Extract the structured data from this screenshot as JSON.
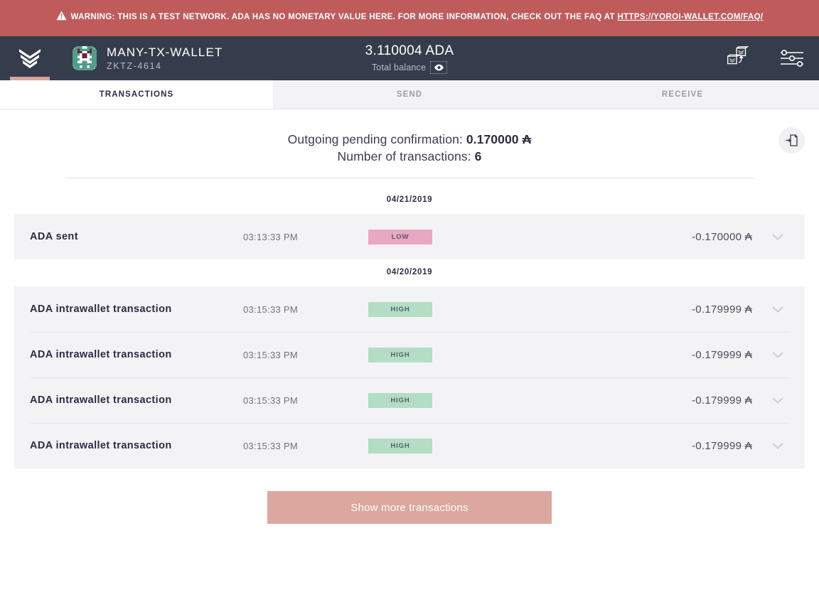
{
  "warning": {
    "icon": "warning-triangle-icon",
    "text": "WARNING: THIS IS A TEST NETWORK. ADA HAS NO MONETARY VALUE HERE. FOR MORE INFORMATION, CHECK OUT THE FAQ AT ",
    "link_text": "HTTPS://YOROI-WALLET.COM/FAQ/",
    "bg_color": "#bf5b5b"
  },
  "navbar": {
    "logo_name": "yoroi-logo",
    "wallet_name": "MANY-TX-WALLET",
    "wallet_plate": "ZKTZ-4614",
    "balance_amount": "3.110004 ADA",
    "balance_label": "Total balance",
    "eye_icon": "eye-icon",
    "wallet_switch_icon": "wallet-switch-icon",
    "settings_icon": "settings-sliders-icon",
    "bg_color": "#353d4c",
    "indicator_color": "#d9a59d"
  },
  "tabs": [
    {
      "label": "TRANSACTIONS",
      "active": true
    },
    {
      "label": "SEND",
      "active": false
    },
    {
      "label": "RECEIVE",
      "active": false
    }
  ],
  "summary": {
    "pending_label": "Outgoing pending confirmation:",
    "pending_value": "0.170000 ₳",
    "count_label": "Number of transactions:",
    "count_value": "6",
    "export_icon": "export-file-icon"
  },
  "transaction_groups": [
    {
      "date": "04/21/2019",
      "rows": [
        {
          "type": "ADA sent",
          "time": "03:13:33 PM",
          "badge": "LOW",
          "badge_style": "badge-low",
          "badge_color": "#e9a8c1",
          "amount": "-0.170000 ₳",
          "chevron": "chevron-down-icon"
        }
      ]
    },
    {
      "date": "04/20/2019",
      "rows": [
        {
          "type": "ADA intrawallet transaction",
          "time": "03:15:33 PM",
          "badge": "HIGH",
          "badge_style": "badge-high",
          "badge_color": "#b3ddc5",
          "amount": "-0.179999 ₳",
          "chevron": "chevron-down-icon"
        },
        {
          "type": "ADA intrawallet transaction",
          "time": "03:15:33 PM",
          "badge": "HIGH",
          "badge_style": "badge-high",
          "badge_color": "#b3ddc5",
          "amount": "-0.179999 ₳",
          "chevron": "chevron-down-icon"
        },
        {
          "type": "ADA intrawallet transaction",
          "time": "03:15:33 PM",
          "badge": "HIGH",
          "badge_style": "badge-high",
          "badge_color": "#b3ddc5",
          "amount": "-0.179999 ₳",
          "chevron": "chevron-down-icon"
        },
        {
          "type": "ADA intrawallet transaction",
          "time": "03:15:33 PM",
          "badge": "HIGH",
          "badge_style": "badge-high",
          "badge_color": "#b3ddc5",
          "amount": "-0.179999 ₳",
          "chevron": "chevron-down-icon"
        }
      ]
    }
  ],
  "show_more": {
    "label": "Show more transactions",
    "color": "#dca79e"
  }
}
